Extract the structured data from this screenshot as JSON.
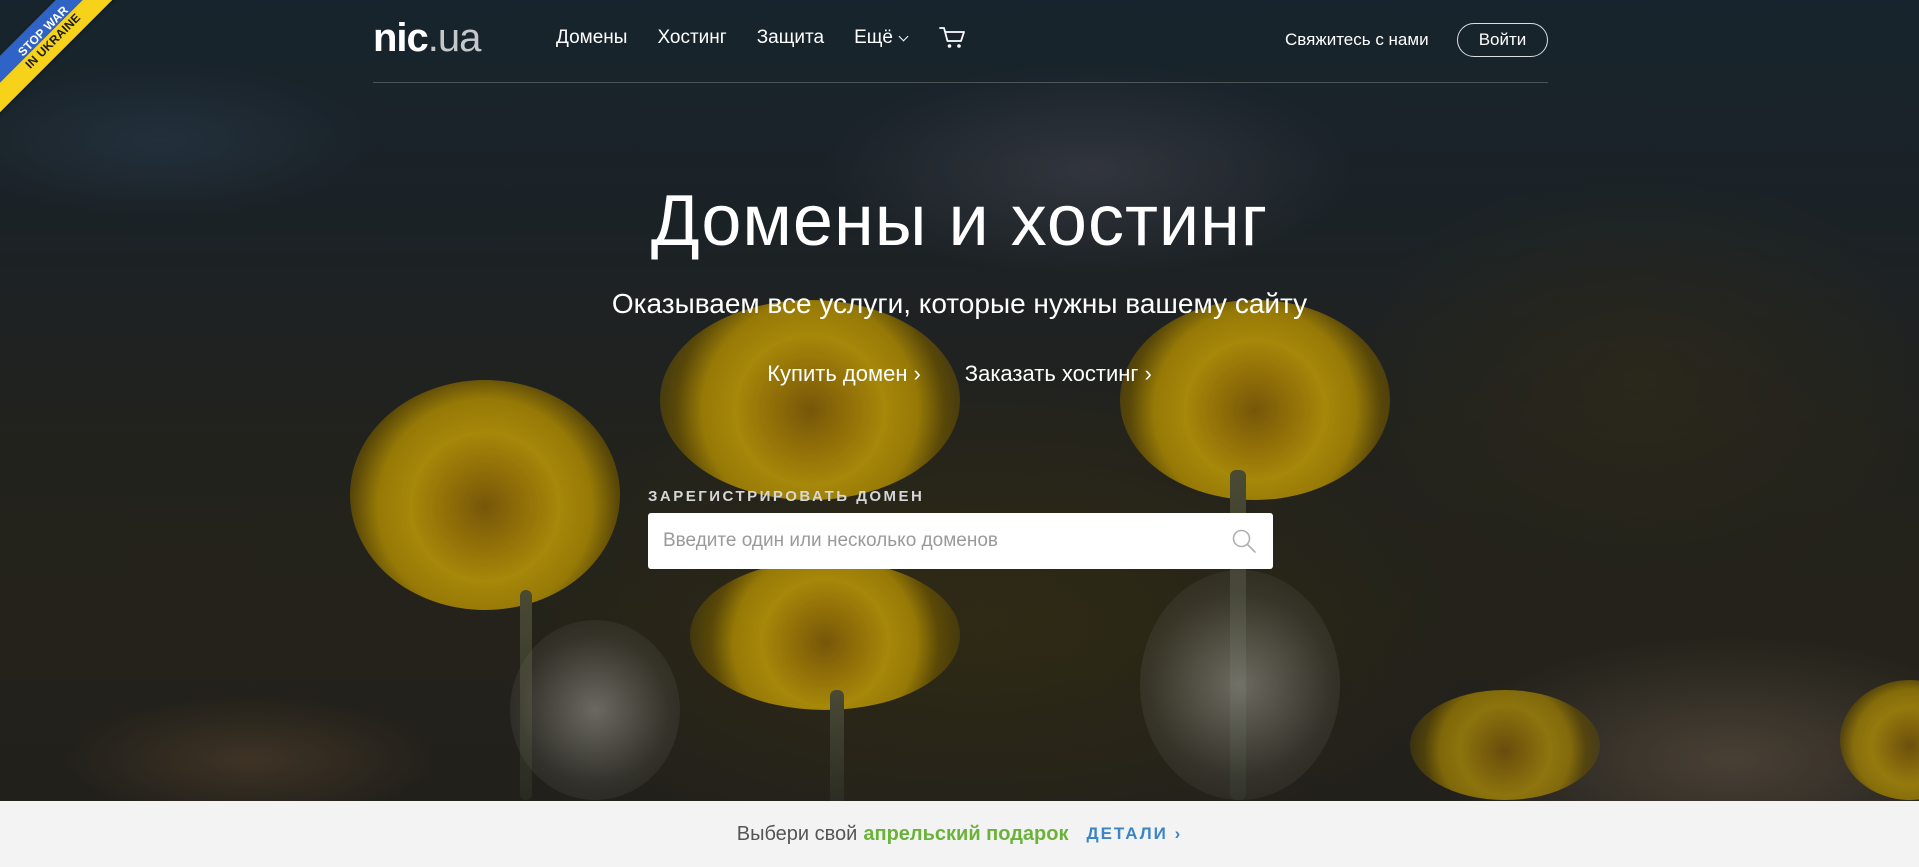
{
  "ribbon": {
    "line1": "STOP WAR",
    "line2": "IN UKRAINE"
  },
  "header": {
    "logo_main": "nic",
    "logo_tld": ".ua",
    "nav": [
      {
        "label": "Домены"
      },
      {
        "label": "Хостинг"
      },
      {
        "label": "Защита"
      },
      {
        "label": "Ещё"
      }
    ],
    "cart_icon": "cart-icon",
    "contact_label": "Свяжитесь с нами",
    "login_label": "Войти"
  },
  "hero": {
    "title": "Домены и хостинг",
    "subtitle": "Оказываем все услуги, которые нужны вашему сайту",
    "buy_domain": "Купить домен",
    "order_hosting": "Заказать хостинг",
    "arrow": "›"
  },
  "domain_search": {
    "label": "ЗАРЕГИСТРИРОВАТЬ ДОМЕН",
    "placeholder": "Введите один или несколько доменов",
    "value": "",
    "icon": "search-icon"
  },
  "promo": {
    "text": "Выбери свой",
    "highlight": "апрельский подарок",
    "link": "ДЕТАЛИ ›",
    "highlight_color": "#6bb23a",
    "link_color": "#3a85c6"
  }
}
